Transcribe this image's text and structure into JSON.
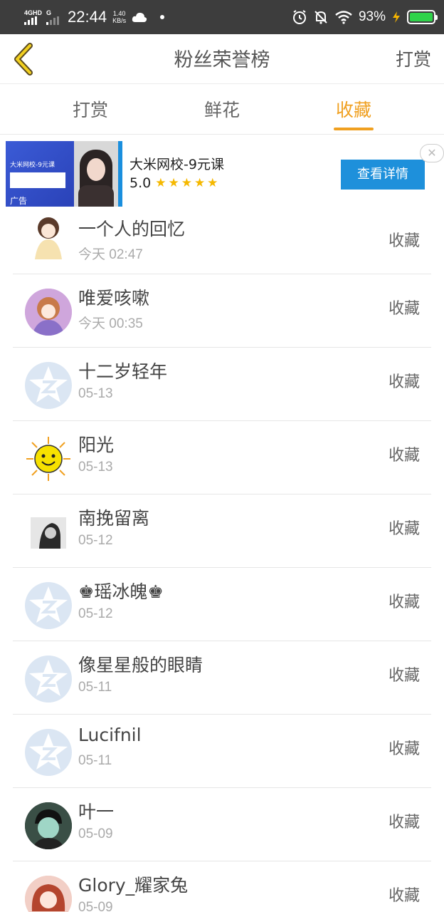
{
  "status_bar": {
    "network": "4GHD",
    "network2": "G",
    "time": "22:44",
    "speed_value": "1.40",
    "speed_unit": "KB/s",
    "battery": "93%"
  },
  "header": {
    "title": "粉丝荣誉榜",
    "right_action": "打赏"
  },
  "tabs": [
    {
      "label": "打赏",
      "active": false
    },
    {
      "label": "鲜花",
      "active": false
    },
    {
      "label": "收藏",
      "active": true
    }
  ],
  "ad": {
    "image_text": "大米网校-9元课",
    "image_badge": "广告",
    "title": "大米网校-9元课",
    "rating": "5.0",
    "stars": "★★★★★",
    "button": "查看详情",
    "close": "✕"
  },
  "list": [
    {
      "name": "一个人的回忆",
      "time": "今天 02:47",
      "action": "收藏",
      "avatar": "anime-girl-avatar"
    },
    {
      "name": "唯爱咳嗽",
      "time": "今天 00:35",
      "action": "收藏",
      "avatar": "anime-girl-purple-avatar"
    },
    {
      "name": "十二岁轻年",
      "time": "05-13",
      "action": "收藏",
      "avatar": "default-star-avatar"
    },
    {
      "name": "阳光",
      "time": "05-13",
      "action": "收藏",
      "avatar": "sun-smiley-avatar"
    },
    {
      "name": "南挽留离",
      "time": "05-12",
      "action": "收藏",
      "avatar": "photo-avatar"
    },
    {
      "name": "♚瑶冰魄♚",
      "time": "05-12",
      "action": "收藏",
      "avatar": "default-star-avatar"
    },
    {
      "name": "像星星般的眼睛",
      "time": "05-11",
      "action": "收藏",
      "avatar": "default-star-avatar"
    },
    {
      "name": "Lucifnil",
      "time": "05-11",
      "action": "收藏",
      "avatar": "default-star-avatar"
    },
    {
      "name": "叶一",
      "time": "05-09",
      "action": "收藏",
      "avatar": "boy-photo-avatar"
    },
    {
      "name": "Glory_耀家兔",
      "time": "05-09",
      "action": "收藏",
      "avatar": "girl-photo-avatar"
    }
  ]
}
